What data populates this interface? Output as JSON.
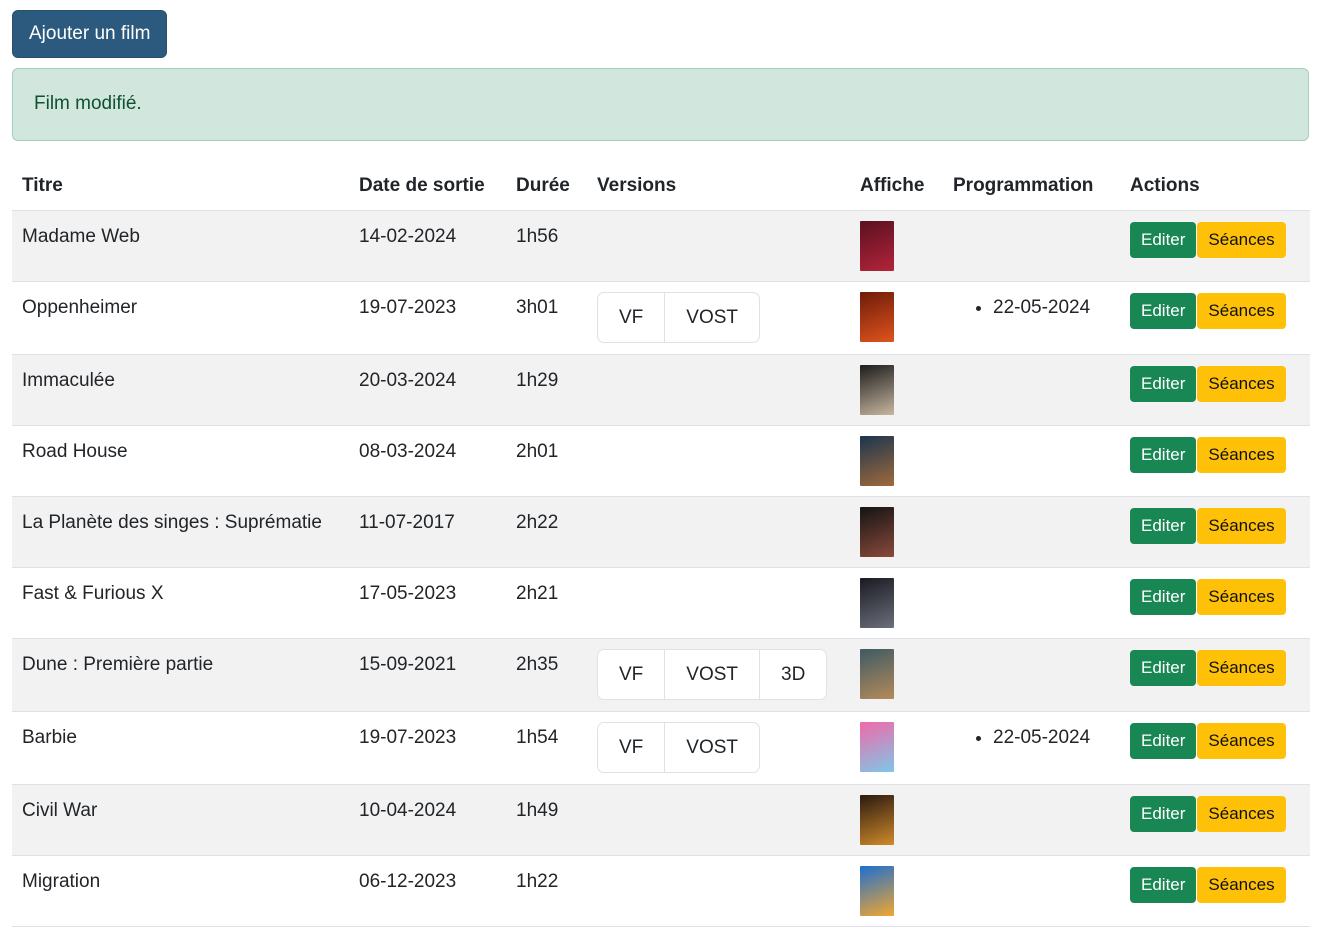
{
  "toolbar": {
    "add_label": "Ajouter un film"
  },
  "alert": {
    "message": "Film modifié."
  },
  "table": {
    "headers": {
      "title": "Titre",
      "release": "Date de sortie",
      "duration": "Durée",
      "versions": "Versions",
      "poster": "Affiche",
      "schedule": "Programmation",
      "actions": "Actions"
    },
    "edit_label": "Editer",
    "sessions_label": "Séances",
    "rows": [
      {
        "title": "Madame Web",
        "release": "14-02-2024",
        "duration": "1h56",
        "versions": [],
        "schedule": [],
        "poster_colors": [
          "#5a1020",
          "#b3243a"
        ]
      },
      {
        "title": "Oppenheimer",
        "release": "19-07-2023",
        "duration": "3h01",
        "versions": [
          "VF",
          "VOST"
        ],
        "schedule": [
          "22-05-2024"
        ],
        "poster_colors": [
          "#6e1b0a",
          "#e0541c"
        ]
      },
      {
        "title": "Immaculée",
        "release": "20-03-2024",
        "duration": "1h29",
        "versions": [],
        "schedule": [],
        "poster_colors": [
          "#1c1c1c",
          "#c8b7a0"
        ]
      },
      {
        "title": "Road House",
        "release": "08-03-2024",
        "duration": "2h01",
        "versions": [],
        "schedule": [],
        "poster_colors": [
          "#1b3550",
          "#a06a3a"
        ]
      },
      {
        "title": "La Planète des singes : Suprématie",
        "release": "11-07-2017",
        "duration": "2h22",
        "versions": [],
        "schedule": [],
        "poster_colors": [
          "#141414",
          "#8a4a3a"
        ]
      },
      {
        "title": "Fast & Furious X",
        "release": "17-05-2023",
        "duration": "2h21",
        "versions": [],
        "schedule": [],
        "poster_colors": [
          "#1a1a22",
          "#6b6f7a"
        ]
      },
      {
        "title": "Dune : Première partie",
        "release": "15-09-2021",
        "duration": "2h35",
        "versions": [
          "VF",
          "VOST",
          "3D"
        ],
        "schedule": [],
        "poster_colors": [
          "#3e5a63",
          "#b48a5a"
        ]
      },
      {
        "title": "Barbie",
        "release": "19-07-2023",
        "duration": "1h54",
        "versions": [
          "VF",
          "VOST"
        ],
        "schedule": [
          "22-05-2024"
        ],
        "poster_colors": [
          "#f06aa8",
          "#7fc6e8"
        ]
      },
      {
        "title": "Civil War",
        "release": "10-04-2024",
        "duration": "1h49",
        "versions": [],
        "schedule": [],
        "poster_colors": [
          "#2a1a10",
          "#d08a2a"
        ]
      },
      {
        "title": "Migration",
        "release": "06-12-2023",
        "duration": "1h22",
        "versions": [],
        "schedule": [],
        "poster_colors": [
          "#1e6fd0",
          "#f2a630"
        ]
      }
    ]
  }
}
